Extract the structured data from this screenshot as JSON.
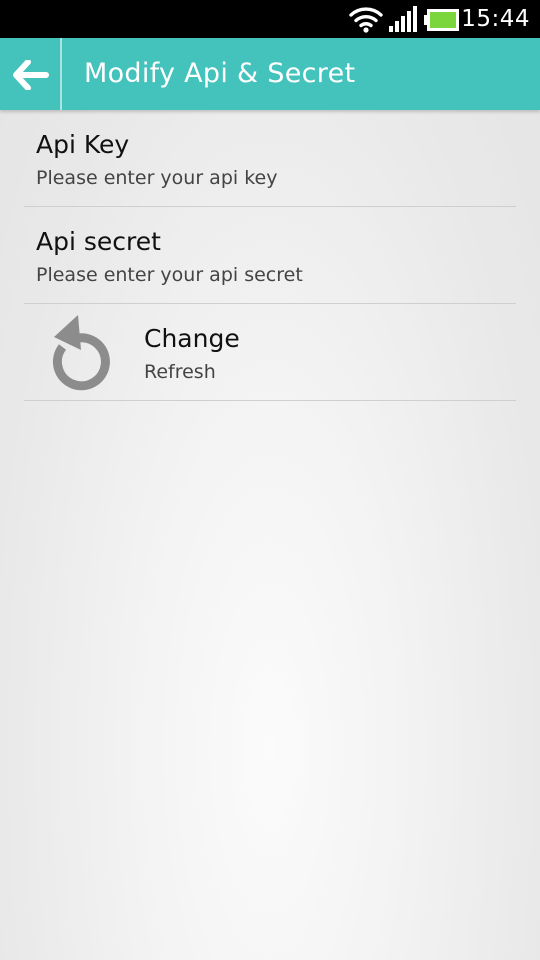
{
  "status_bar": {
    "time": "15:44",
    "icons": [
      "wifi-icon",
      "signal-icon",
      "battery-icon"
    ],
    "battery_color": "#7ad63a"
  },
  "action_bar": {
    "title": "Modify Api & Secret",
    "back_icon": "back-arrow-icon",
    "background": "#44c3bc"
  },
  "settings": [
    {
      "title": "Api Key",
      "summary": "Please enter your api key"
    },
    {
      "title": "Api secret",
      "summary": "Please enter your api secret"
    },
    {
      "title": "Change",
      "summary": "Refresh",
      "icon": "refresh-icon"
    }
  ]
}
